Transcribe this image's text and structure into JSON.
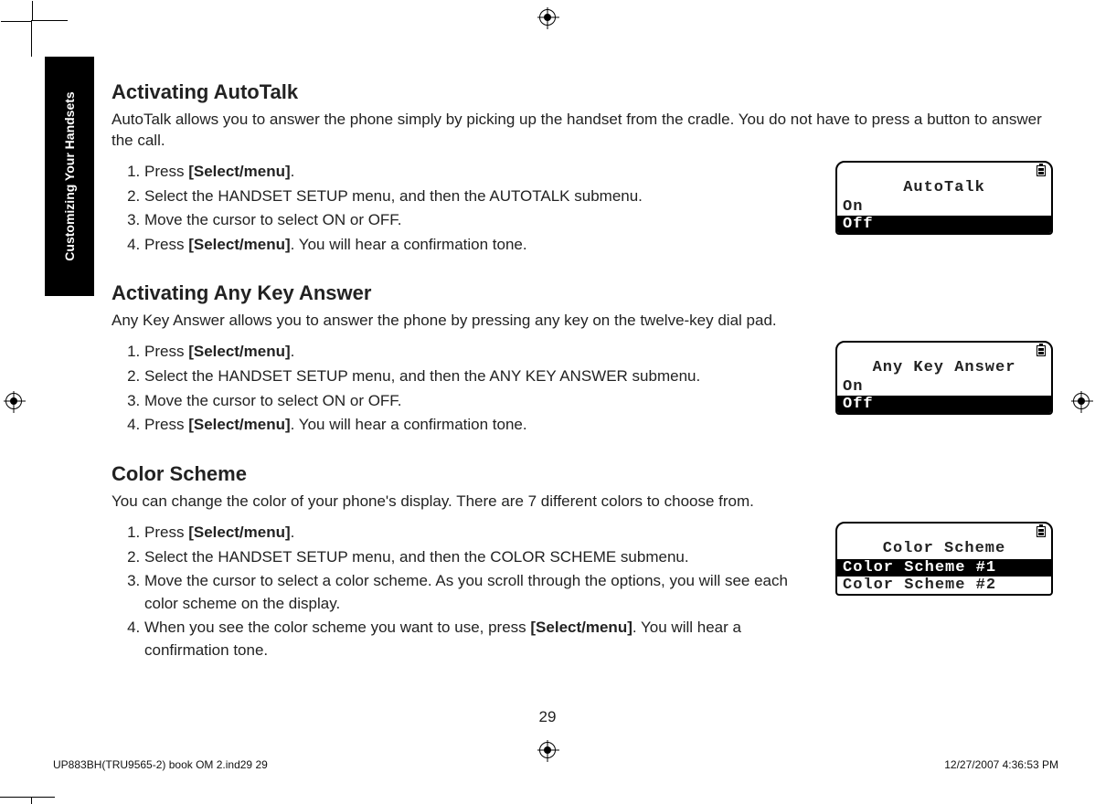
{
  "side_tab": "Customizing Your Handsets",
  "sections": {
    "autotalk": {
      "heading": "Activating AutoTalk",
      "lead": "AutoTalk allows you to answer the phone simply by picking up the handset from the cradle. You do not have to press a button to answer the call.",
      "steps": {
        "s1a": "Press ",
        "s1b": "[Select/menu]",
        "s1c": ".",
        "s2": "Select the HANDSET SETUP menu, and then the AUTOTALK submenu.",
        "s3": "Move the cursor to select ON or OFF.",
        "s4a": "Press ",
        "s4b": "[Select/menu]",
        "s4c": ". You will hear a confirmation tone."
      },
      "lcd": {
        "title": "AutoTalk",
        "opt1": "On",
        "opt2": "Off",
        "selected": 2
      }
    },
    "anykey": {
      "heading": "Activating Any Key Answer",
      "lead": "Any Key Answer allows you to answer the phone by pressing any key on the twelve-key dial pad.",
      "steps": {
        "s1a": "Press ",
        "s1b": "[Select/menu]",
        "s1c": ".",
        "s2": "Select the HANDSET SETUP menu, and then the ANY KEY ANSWER submenu.",
        "s3": "Move the cursor to select ON or OFF.",
        "s4a": "Press ",
        "s4b": "[Select/menu]",
        "s4c": ". You will hear a confirmation tone."
      },
      "lcd": {
        "title": "Any Key Answer",
        "opt1": "On",
        "opt2": "Off",
        "selected": 2
      }
    },
    "color": {
      "heading": "Color Scheme",
      "lead": "You can change the color of your phone's display. There are 7 different colors to choose from.",
      "steps": {
        "s1a": "Press ",
        "s1b": "[Select/menu]",
        "s1c": ".",
        "s2": "Select the HANDSET SETUP menu, and then the COLOR SCHEME submenu.",
        "s3": "Move the cursor to select a color scheme. As you scroll through the options, you will see each color scheme on the display.",
        "s4a": "When you see the color scheme you want to use, press ",
        "s4b": "[Select/menu]",
        "s4c": ". You will hear a confirmation tone."
      },
      "lcd": {
        "title": "Color Scheme",
        "opt1": "Color Scheme #1",
        "opt2": "Color Scheme #2",
        "selected": 1
      }
    }
  },
  "page_number": "29",
  "footer": {
    "left": "UP883BH(TRU9565-2) book OM 2.ind29   29",
    "right": "12/27/2007   4:36:53 PM"
  }
}
